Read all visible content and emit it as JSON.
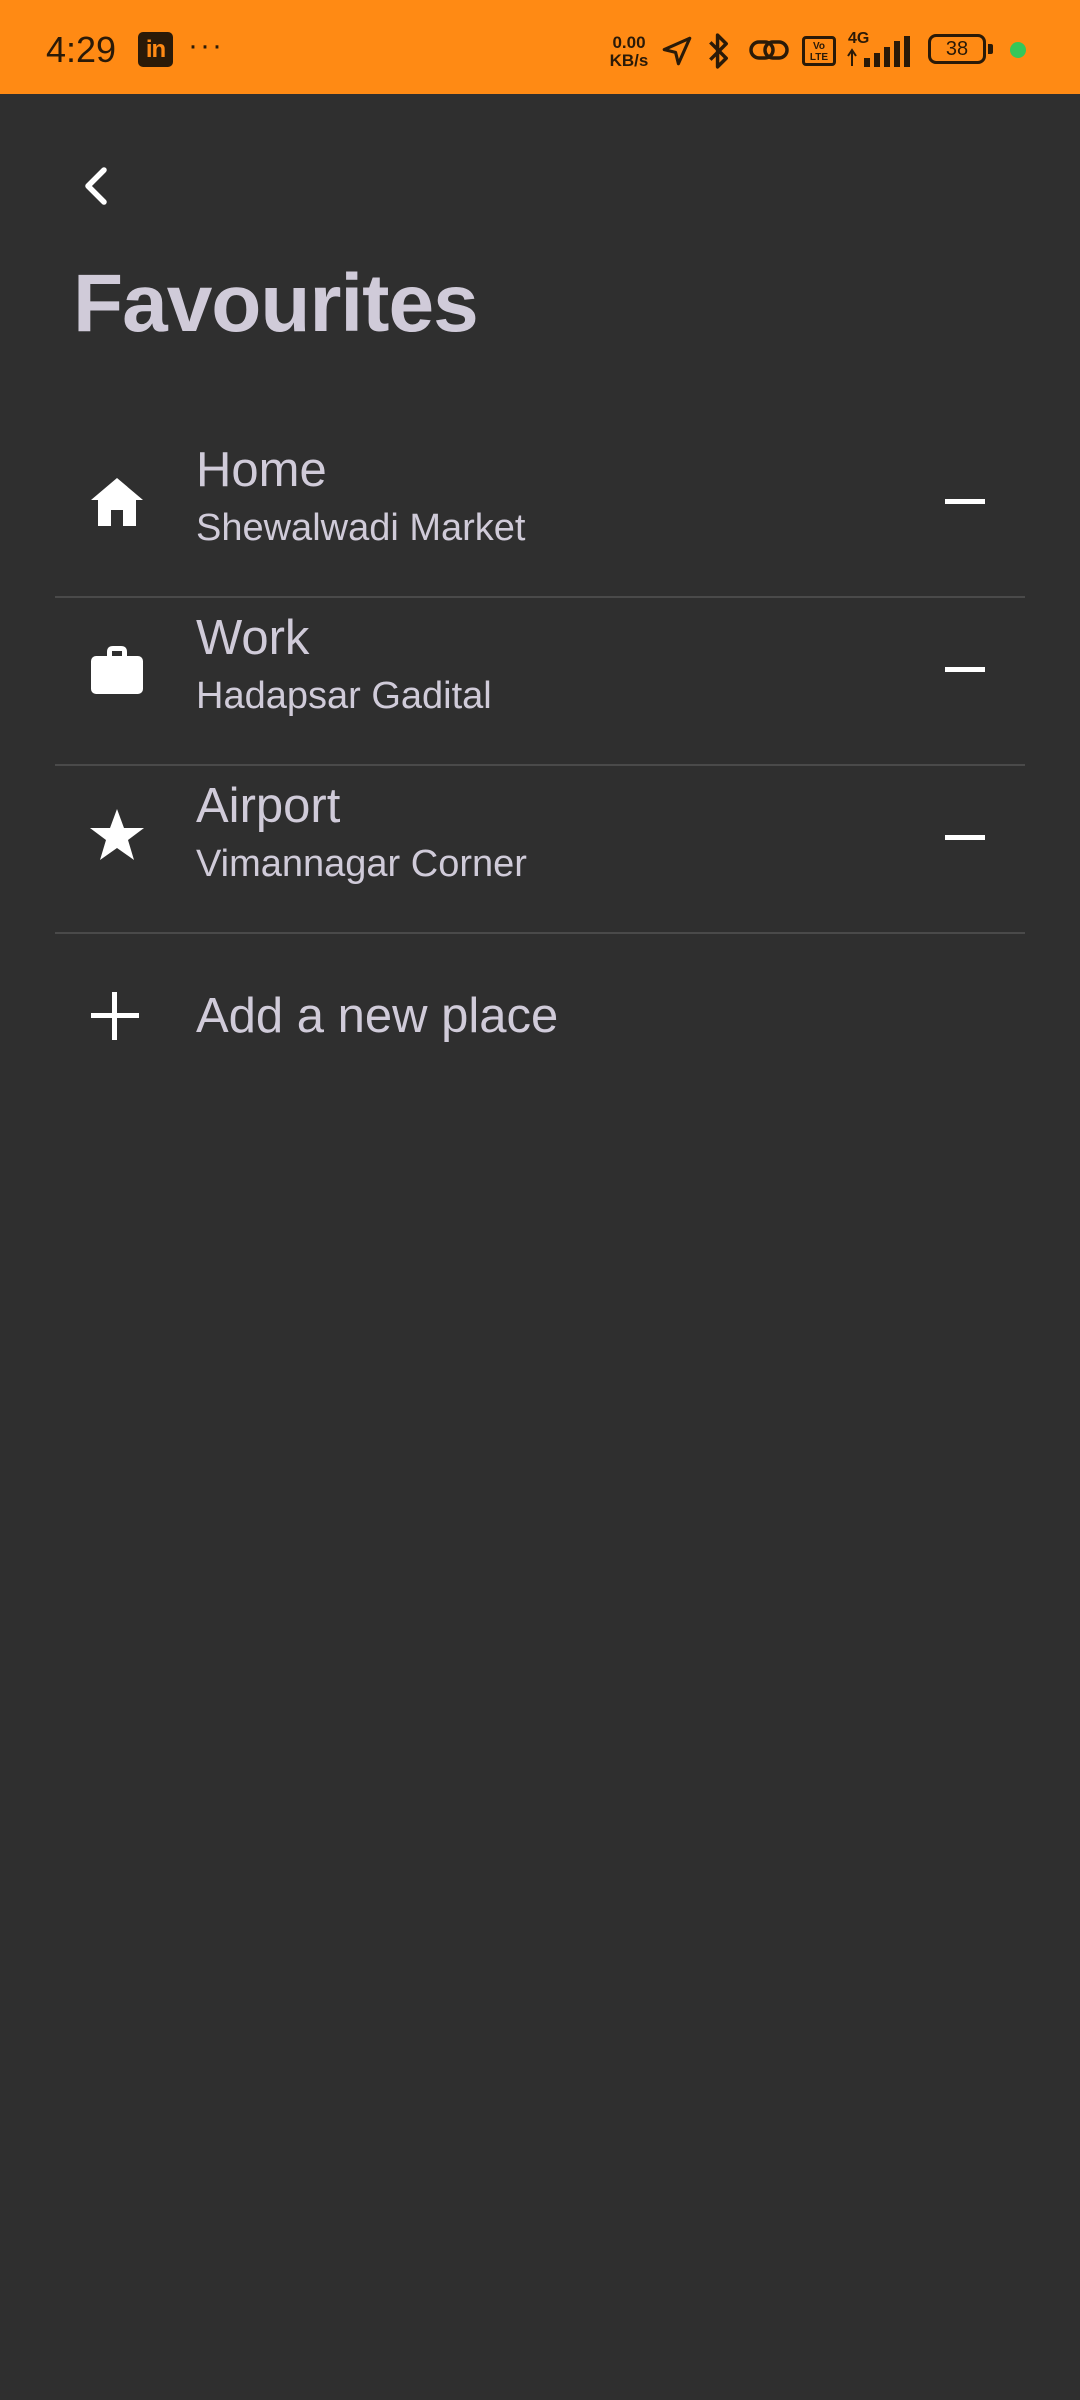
{
  "status_bar": {
    "time": "4:29",
    "app_icon": "LinkedIn",
    "linkedin_label": "in",
    "more_dots": "···",
    "net_speed": "0.00",
    "net_speed_unit": "KB/s",
    "volte_label": "Vo LTE",
    "network_type": "4G",
    "battery": "38",
    "icons": [
      "linkedin-icon",
      "navigation-icon",
      "bluetooth-icon",
      "link-icon",
      "volte-icon",
      "signal-icon",
      "battery-icon"
    ],
    "colors": {
      "background": "#ff8a14",
      "dot": "#34c759"
    }
  },
  "header": {
    "back_icon": "chevron-left-icon",
    "title": "Favourites"
  },
  "favourites": [
    {
      "name": "Home",
      "address": "Shewalwadi Market",
      "icon": "home-icon",
      "action_icon": "minus-icon"
    },
    {
      "name": "Work",
      "address": "Hadapsar Gadital",
      "icon": "briefcase-icon",
      "action_icon": "minus-icon"
    },
    {
      "name": "Airport",
      "address": "Vimannagar Corner",
      "icon": "star-icon",
      "action_icon": "minus-icon"
    }
  ],
  "add_place": {
    "label": "Add a new place",
    "icon": "plus-icon"
  },
  "theme": {
    "background": "#2f2f2f",
    "text": "#d0cbd9",
    "divider": "#4a4a4a",
    "icon": "#ffffff"
  }
}
